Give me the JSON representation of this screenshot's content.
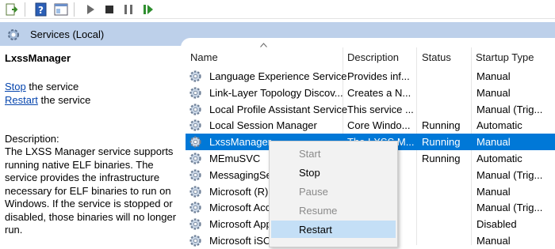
{
  "toolbar": {
    "buttons": [
      "export-list-icon",
      "help-icon",
      "properties-icon",
      "play-icon",
      "stop-icon",
      "pause-icon",
      "resume-icon"
    ]
  },
  "header": {
    "title": "Services (Local)"
  },
  "left_pane": {
    "service_name": "LxssManager",
    "stop_link": "Stop",
    "stop_suffix": " the service",
    "restart_link": "Restart",
    "restart_suffix": " the service",
    "description_label": "Description:",
    "description": "The LXSS Manager service supports running native ELF binaries. The service provides the infrastructure necessary for ELF binaries to run on Windows. If the service is stopped or disabled, those binaries will no longer run."
  },
  "columns": [
    "Name",
    "Description",
    "Status",
    "Startup Type"
  ],
  "rows": [
    {
      "name": "Language Experience Service",
      "description": "Provides inf...",
      "status": "",
      "startup": "Manual"
    },
    {
      "name": "Link-Layer Topology Discov...",
      "description": "Creates a N...",
      "status": "",
      "startup": "Manual"
    },
    {
      "name": "Local Profile Assistant Service",
      "description": "This service ...",
      "status": "",
      "startup": "Manual (Trig..."
    },
    {
      "name": "Local Session Manager",
      "description": "Core Windo...",
      "status": "Running",
      "startup": "Automatic"
    },
    {
      "name": "LxssManager",
      "description": "The LXSS M...",
      "status": "Running",
      "startup": "Manual"
    },
    {
      "name": "MEmuSVC",
      "description": "",
      "status": "Running",
      "startup": "Automatic"
    },
    {
      "name": "MessagingSer",
      "description": "",
      "status": "",
      "startup": "Manual (Trig..."
    },
    {
      "name": "Microsoft (R)",
      "description": "",
      "status": "",
      "startup": "Manual"
    },
    {
      "name": "Microsoft Acc",
      "description": "",
      "status": "",
      "startup": "Manual (Trig..."
    },
    {
      "name": "Microsoft App",
      "description": "",
      "status": "",
      "startup": "Disabled"
    },
    {
      "name": "Microsoft iSCS",
      "description": "",
      "status": "",
      "startup": "Manual"
    }
  ],
  "context_menu": {
    "items": [
      {
        "label": "Start",
        "enabled": false
      },
      {
        "label": "Stop",
        "enabled": true
      },
      {
        "label": "Pause",
        "enabled": false
      },
      {
        "label": "Resume",
        "enabled": false
      },
      {
        "label": "Restart",
        "enabled": true
      }
    ]
  },
  "colors": {
    "header_bg": "#bdd0ea",
    "selection": "#0078d7",
    "menu_hover": "#c4dff6",
    "link": "#0645ad"
  }
}
